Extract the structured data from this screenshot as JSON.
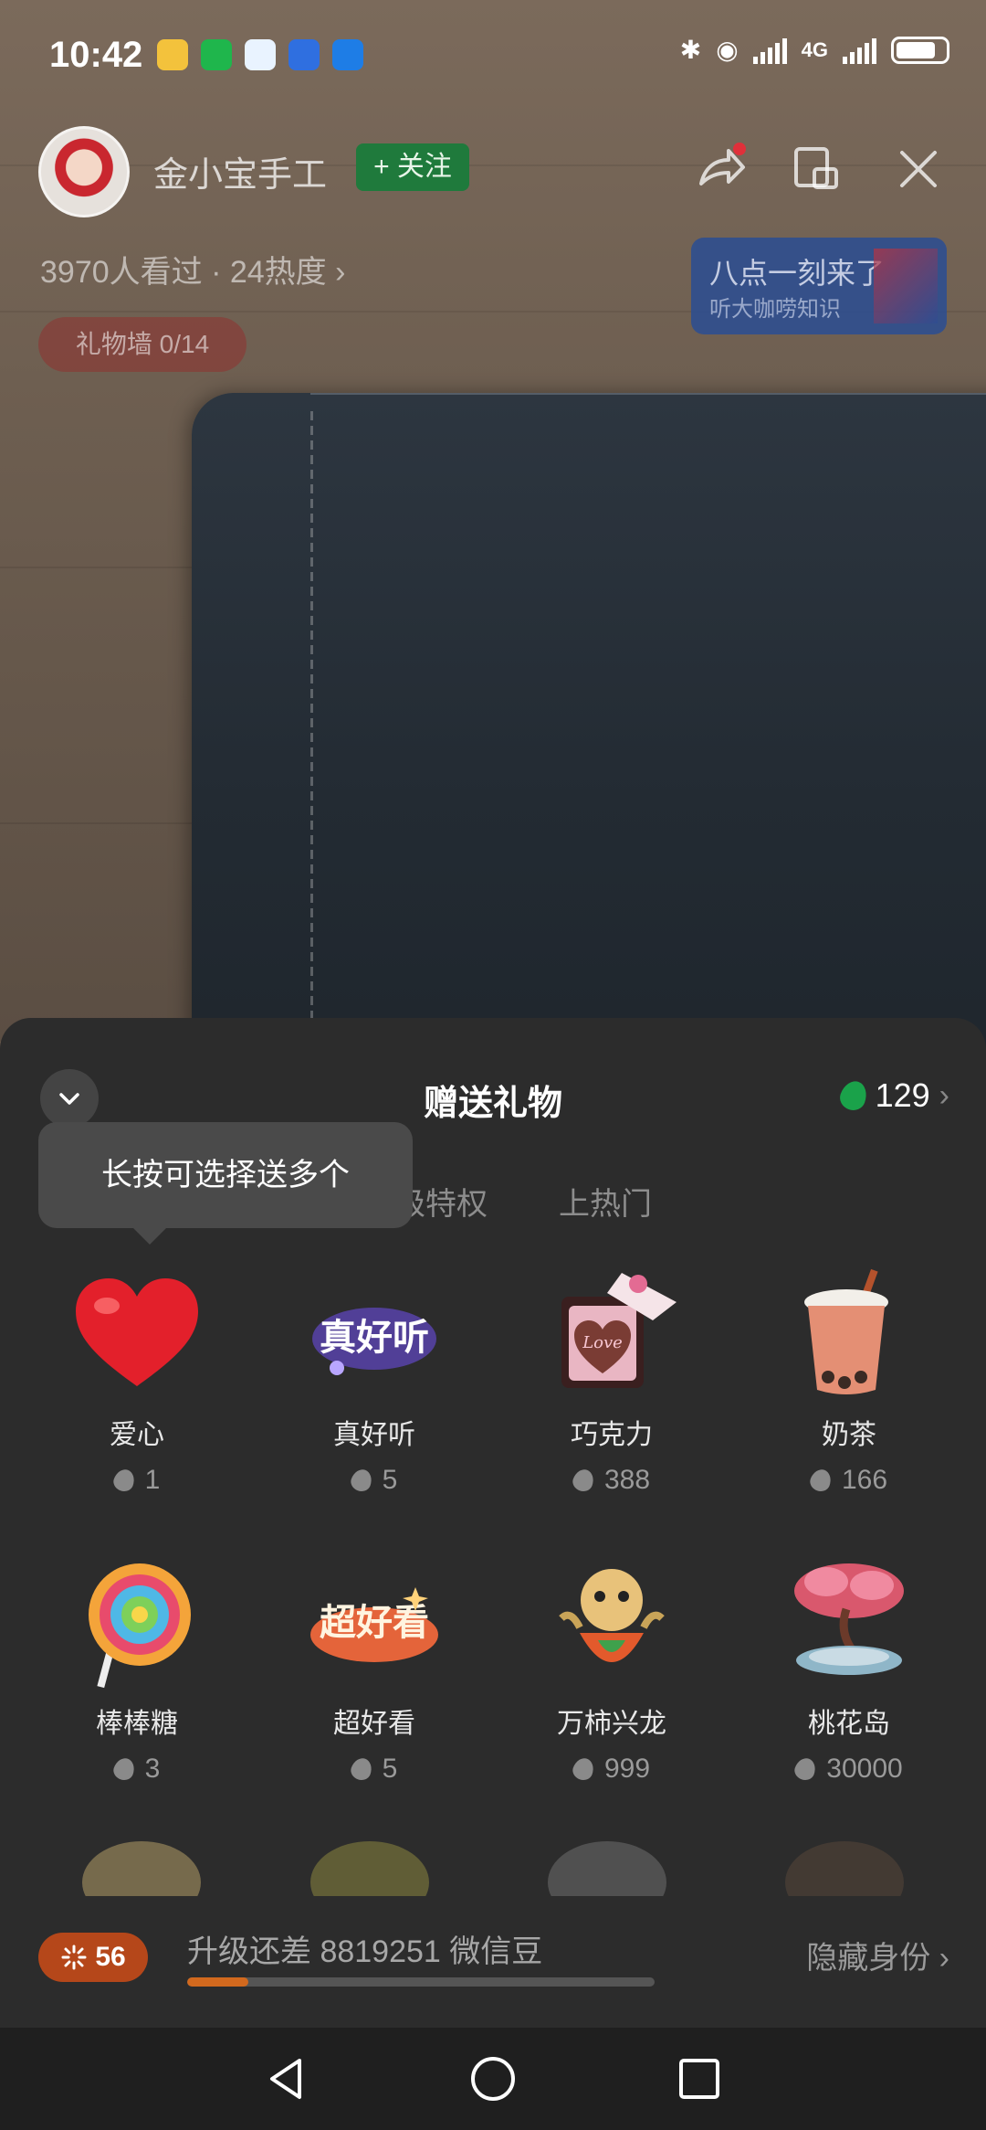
{
  "status_bar": {
    "time": "10:42",
    "network": "4G",
    "notification_icons": [
      "weibo-icon",
      "wechat-icon",
      "chat-bubble-icon",
      "shield-icon",
      "app-icon"
    ]
  },
  "streamer": {
    "name": "金小宝手工",
    "follow_label": "+ 关注",
    "stats": "3970人看过 · 24热度 ›"
  },
  "promo": {
    "line1": "八点一刻来了",
    "line2": "听大咖唠知识"
  },
  "gift_wall": "礼物墙 0/14",
  "panel": {
    "title": "赠送礼物",
    "balance": "129",
    "tooltip": "长按可选择送多个",
    "tabs": [
      "级特权",
      "上热门"
    ]
  },
  "gifts": [
    {
      "name": "爱心",
      "price": "1"
    },
    {
      "name": "真好听",
      "price": "5"
    },
    {
      "name": "巧克力",
      "price": "388"
    },
    {
      "name": "奶茶",
      "price": "166"
    },
    {
      "name": "棒棒糖",
      "price": "3"
    },
    {
      "name": "超好看",
      "price": "5"
    },
    {
      "name": "万柿兴龙",
      "price": "999"
    },
    {
      "name": "桃花岛",
      "price": "30000"
    }
  ],
  "gift_art_text": {
    "zhenhaoting": "真好听",
    "chaohaokan": "超好看",
    "love": "Love"
  },
  "level": {
    "badge": "56",
    "upgrade_text": "升级还差 8819251 微信豆",
    "progress_fraction": 0.13,
    "hide_identity": "隐藏身份 ›"
  },
  "colors": {
    "panel_bg": "#2c2c2c",
    "follow_green": "#1f7a3c",
    "bean_green": "#1aa24a",
    "level_orange": "#b5471a"
  }
}
